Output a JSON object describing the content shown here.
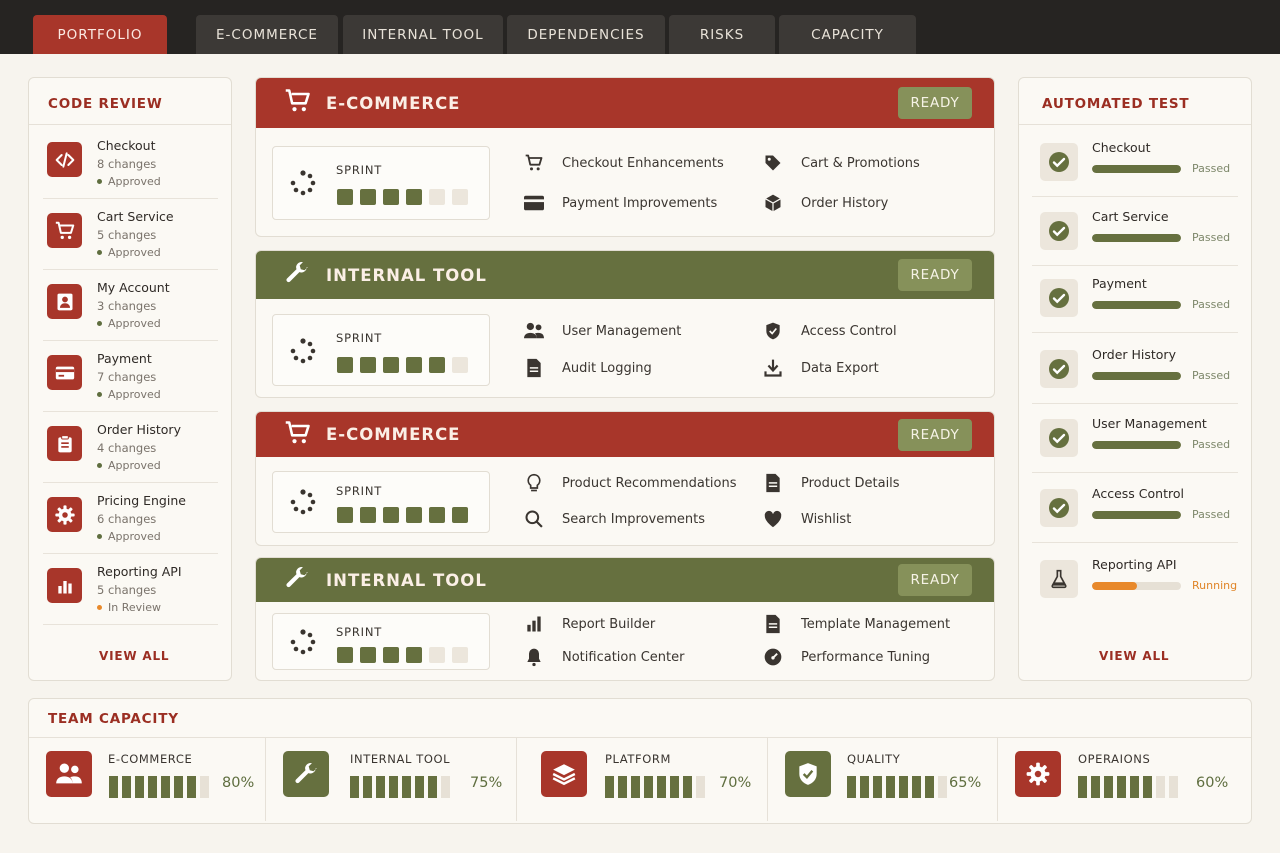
{
  "tabs": [
    {
      "label": "PORTFOLIO",
      "active": true
    },
    {
      "label": "E-COMMERCE",
      "active": false
    },
    {
      "label": "INTERNAL TOOL",
      "active": false
    },
    {
      "label": "DEPENDENCIES",
      "active": false
    },
    {
      "label": "RISKS",
      "active": false
    },
    {
      "label": "CAPACITY",
      "active": false
    }
  ],
  "code_review": {
    "title": "CODE REVIEW",
    "items": [
      {
        "name": "Checkout",
        "changes": "8 changes",
        "status": "Approved",
        "icon": "code-icon"
      },
      {
        "name": "Cart Service",
        "changes": "5 changes",
        "status": "Approved",
        "icon": "cart-icon"
      },
      {
        "name": "My Account",
        "changes": "3 changes",
        "status": "Approved",
        "icon": "user-icon"
      },
      {
        "name": "Payment",
        "changes": "7 changes",
        "status": "Approved",
        "icon": "credit-card-icon"
      },
      {
        "name": "Order History",
        "changes": "4 changes",
        "status": "Approved",
        "icon": "clipboard-icon"
      },
      {
        "name": "Pricing Engine",
        "changes": "6 changes",
        "status": "Approved",
        "icon": "gear-icon"
      },
      {
        "name": "Reporting API",
        "changes": "5 changes",
        "status": "In Review",
        "icon": "bar-chart-icon"
      }
    ],
    "view_all": "VIEW ALL"
  },
  "projects": [
    {
      "title": "E-COMMERCE",
      "theme": "red",
      "status": "READY",
      "sprint_label": "SPRINT",
      "sprint_done": 4,
      "sprint_total": 6,
      "features": [
        "Checkout Enhancements",
        "Cart & Promotions",
        "Payment Improvements",
        "Order History"
      ]
    },
    {
      "title": "INTERNAL TOOL",
      "theme": "green",
      "status": "READY",
      "sprint_label": "SPRINT",
      "sprint_done": 5,
      "sprint_total": 6,
      "features": [
        "User Management",
        "Access Control",
        "Audit Logging",
        "Data Export"
      ]
    },
    {
      "title": "E-COMMERCE",
      "theme": "red",
      "status": "READY",
      "sprint_label": "SPRINT",
      "sprint_done": 6,
      "sprint_total": 6,
      "features": [
        "Product Recommendations",
        "Product Details",
        "Search Improvements",
        "Wishlist"
      ]
    },
    {
      "title": "INTERNAL TOOL",
      "theme": "green",
      "status": "READY",
      "sprint_label": "SPRINT",
      "sprint_done": 4,
      "sprint_total": 6,
      "features": [
        "Report Builder",
        "Template Management",
        "Notification Center",
        "Performance Tuning"
      ]
    }
  ],
  "automated_test": {
    "title": "AUTOMATED TEST",
    "items": [
      {
        "name": "Checkout",
        "status": "Passed",
        "progress": 1.0
      },
      {
        "name": "Cart Service",
        "status": "Passed",
        "progress": 1.0
      },
      {
        "name": "Payment",
        "status": "Passed",
        "progress": 1.0
      },
      {
        "name": "Order History",
        "status": "Passed",
        "progress": 1.0
      },
      {
        "name": "User Management",
        "status": "Passed",
        "progress": 1.0
      },
      {
        "name": "Access Control",
        "status": "Passed",
        "progress": 1.0
      },
      {
        "name": "Reporting API",
        "status": "Running",
        "progress": 0.5
      }
    ],
    "view_all": "VIEW ALL"
  },
  "team_capacity": {
    "title": "TEAM CAPACITY",
    "teams": [
      {
        "name": "E-COMMERCE",
        "percent": "80%",
        "filled": 7,
        "icon": "users-icon",
        "theme": "red"
      },
      {
        "name": "INTERNAL TOOL",
        "percent": "75%",
        "filled": 7,
        "icon": "wrench-icon",
        "theme": "green"
      },
      {
        "name": "PLATFORM",
        "percent": "70%",
        "filled": 7,
        "icon": "layers-icon",
        "theme": "red"
      },
      {
        "name": "QUALITY",
        "percent": "65%",
        "filled": 7,
        "icon": "shield-check-icon",
        "theme": "green"
      },
      {
        "name": "OPERAIONS",
        "percent": "60%",
        "filled": 6,
        "icon": "gear-icon",
        "theme": "red"
      }
    ]
  },
  "colors": {
    "accent_red": "#a8362a",
    "accent_green": "#66703f",
    "ready_badge": "#86915a",
    "running_orange": "#e8892b",
    "topbar": "#262422",
    "background": "#f7f4ee"
  }
}
